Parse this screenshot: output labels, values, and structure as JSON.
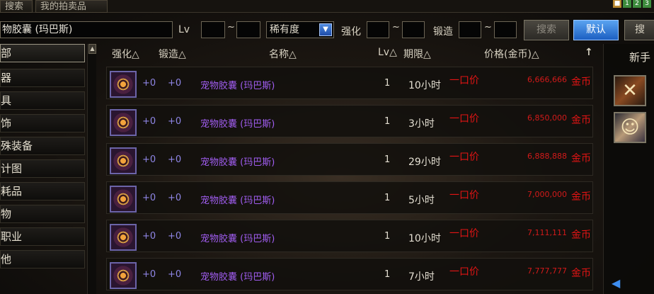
{
  "tabs": [
    {
      "label": "搜索"
    },
    {
      "label": "我的拍卖品"
    }
  ],
  "top_icons": [
    "■",
    "1",
    "2",
    "3"
  ],
  "search": {
    "name_value": "物胶囊 (玛巴斯)",
    "lv_label": "Lv",
    "tilde": "~",
    "rarity_value": "稀有度",
    "rarity_arrow": "▼",
    "enhance_label": "强化",
    "forge_label": "锻造",
    "search_button": "搜索",
    "default_button": "默认",
    "search_button2": "搜"
  },
  "categories": [
    {
      "label": "部"
    },
    {
      "label": "器"
    },
    {
      "label": "具"
    },
    {
      "label": "饰"
    },
    {
      "label": "殊装备"
    },
    {
      "label": "计图"
    },
    {
      "label": "耗品"
    },
    {
      "label": "物"
    },
    {
      "label": "职业"
    },
    {
      "label": "他"
    }
  ],
  "scroll_up": "▲",
  "columns": {
    "enhance": "强化△",
    "forge": "锻造△",
    "name": "名称△",
    "lv": "Lv△",
    "duration": "期限△",
    "price": "价格(金币)△",
    "sort_icon": "↑"
  },
  "rows": [
    {
      "enhance": "+0",
      "forge": "+0",
      "name": "宠物胶囊 (玛巴斯)",
      "lv": "1",
      "duration": "10小时",
      "buyout": "一口价",
      "price": "6,666,666",
      "currency": "金币"
    },
    {
      "enhance": "+0",
      "forge": "+0",
      "name": "宠物胶囊 (玛巴斯)",
      "lv": "1",
      "duration": "3小时",
      "buyout": "一口价",
      "price": "6,850,000",
      "currency": "金币"
    },
    {
      "enhance": "+0",
      "forge": "+0",
      "name": "宠物胶囊 (玛巴斯)",
      "lv": "1",
      "duration": "29小时",
      "buyout": "一口价",
      "price": "6,888,888",
      "currency": "金币"
    },
    {
      "enhance": "+0",
      "forge": "+0",
      "name": "宠物胶囊 (玛巴斯)",
      "lv": "1",
      "duration": "5小时",
      "buyout": "一口价",
      "price": "7,000,000",
      "currency": "金币"
    },
    {
      "enhance": "+0",
      "forge": "+0",
      "name": "宠物胶囊 (玛巴斯)",
      "lv": "1",
      "duration": "10小时",
      "buyout": "一口价",
      "price": "7,111,111",
      "currency": "金币"
    },
    {
      "enhance": "+0",
      "forge": "+0",
      "name": "宠物胶囊 (玛巴斯)",
      "lv": "1",
      "duration": "7小时",
      "buyout": "一口价",
      "price": "7,777,777",
      "currency": "金币"
    }
  ],
  "right_panel": {
    "title": "新手",
    "slot_icons": [
      "✕",
      "☺"
    ]
  },
  "bottom_arrow": "◀",
  "colors": {
    "item_name": "#a05df0",
    "price": "#d21a1a",
    "enhance_value": "#8f86e6",
    "default_button": "#1c5fc2"
  }
}
